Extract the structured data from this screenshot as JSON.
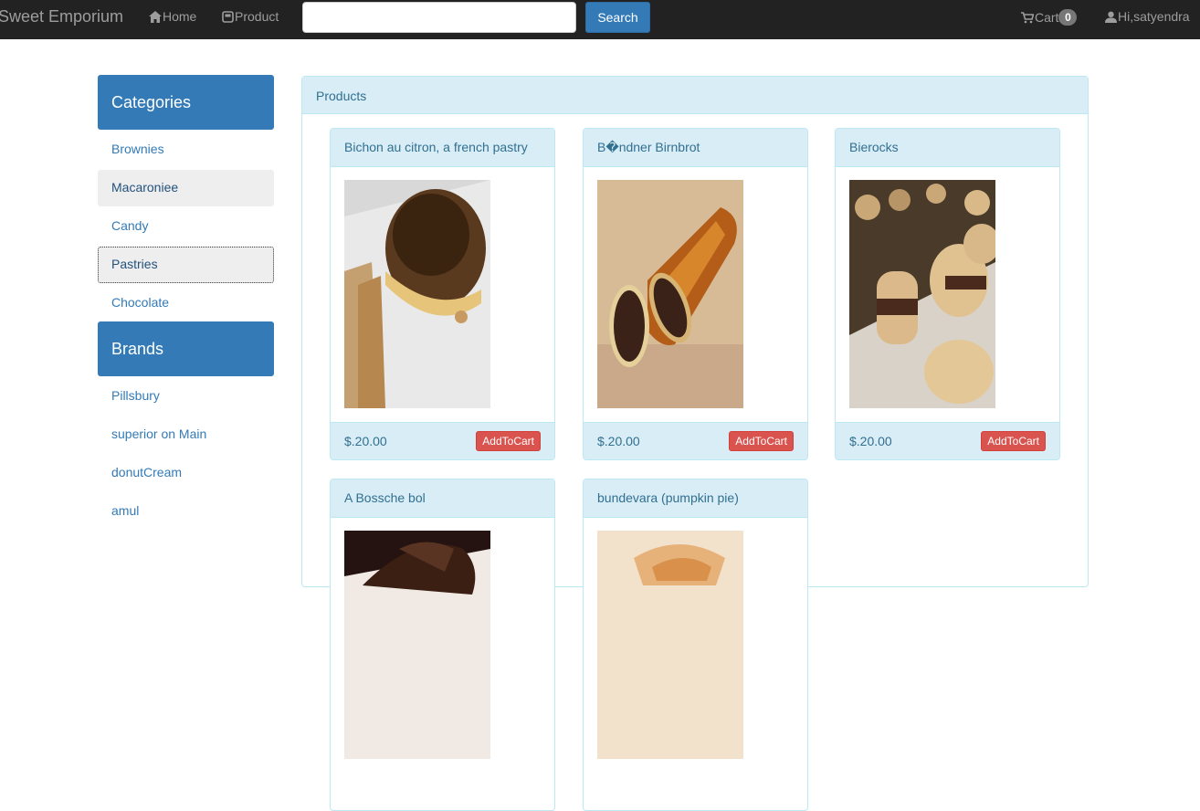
{
  "navbar": {
    "brand": "Sweet Emporium",
    "home_label": "Home",
    "product_label": "Product",
    "search_value": "",
    "search_button": "Search",
    "cart_label": "Cart",
    "cart_count": "0",
    "user_label": "Hi,satyendra",
    "bg_color": "#222222"
  },
  "sidebar": {
    "categories_title": "Categories",
    "categories": [
      {
        "label": "Brownies"
      },
      {
        "label": "Macaroniee"
      },
      {
        "label": "Candy"
      },
      {
        "label": "Pastries"
      },
      {
        "label": "Chocolate"
      }
    ],
    "brands_title": "Brands",
    "brands": [
      {
        "label": "Pillsbury"
      },
      {
        "label": "superior on Main"
      },
      {
        "label": "donutCream"
      },
      {
        "label": "amul"
      }
    ]
  },
  "products": {
    "title": "Products",
    "items": [
      {
        "name": "Bichon au citron, a french pastry",
        "price": "$.20.00",
        "button": "AddToCart"
      },
      {
        "name": "B�ndner Birnbrot",
        "price": "$.20.00",
        "button": "AddToCart"
      },
      {
        "name": "Bierocks",
        "price": "$.20.00",
        "button": "AddToCart"
      },
      {
        "name": "A Bossche bol",
        "price": "",
        "button": ""
      },
      {
        "name": "bundevara (pumpkin pie)",
        "price": "",
        "button": ""
      }
    ]
  },
  "colors": {
    "primary": "#337ab7",
    "panel_info": "#d9edf7",
    "danger": "#d9534f"
  }
}
